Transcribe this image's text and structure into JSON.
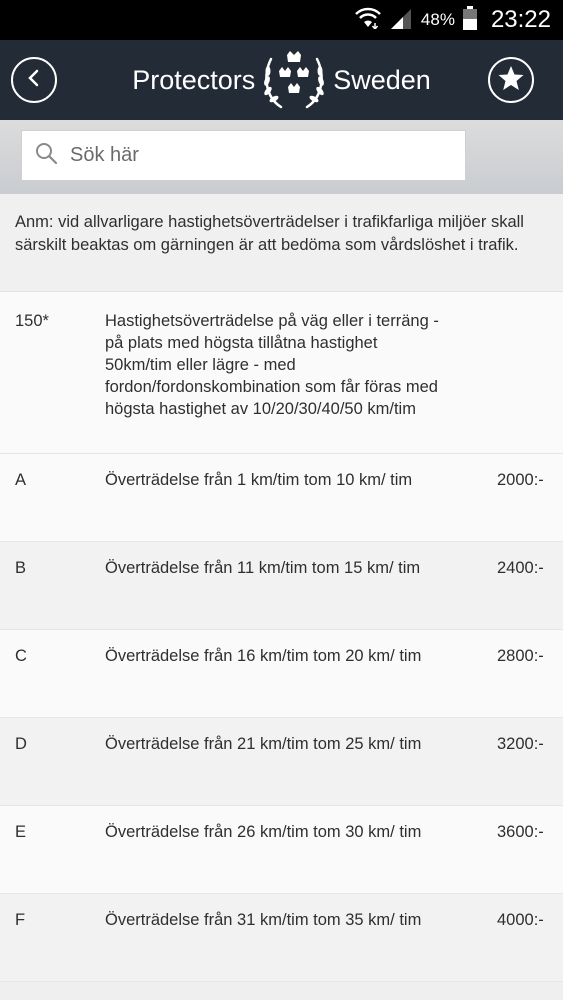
{
  "status_bar": {
    "battery": "48%",
    "time": "23:22"
  },
  "header": {
    "title_left": "Protectors",
    "title_right": "Sweden"
  },
  "search": {
    "placeholder": "Sök här"
  },
  "note": "Anm: vid allvarligare hastighetsöverträdelser i trafikfarliga miljöer skall särskilt beaktas om gärningen är att bedöma som vårdslöshet i trafik.",
  "section": {
    "code": "150*",
    "description": "Hastighetsöverträdelse på väg eller i terräng - på plats med högsta tillåtna hastighet 50km/tim eller lägre - med fordon/fordonskombination som får föras med högsta hastighet av 10/20/30/40/50 km/tim"
  },
  "items": [
    {
      "code": "A",
      "text": "Överträdelse från 1 km/tim tom 10 km/ tim",
      "price": "2000:-"
    },
    {
      "code": "B",
      "text": "Överträdelse från 11 km/tim tom 15 km/ tim",
      "price": "2400:-"
    },
    {
      "code": "C",
      "text": "Överträdelse från 16 km/tim tom 20 km/ tim",
      "price": "2800:-"
    },
    {
      "code": "D",
      "text": "Överträdelse från 21 km/tim tom 25 km/ tim",
      "price": "3200:-"
    },
    {
      "code": "E",
      "text": "Överträdelse från 26 km/tim tom 30 km/ tim",
      "price": "3600:-"
    },
    {
      "code": "F",
      "text": "Överträdelse från 31 km/tim tom 35 km/ tim",
      "price": "4000:-"
    }
  ],
  "icons": {
    "wifi": "wifi-icon",
    "signal": "signal-icon",
    "battery": "battery-icon",
    "back": "chevron-left-icon",
    "crest": "crown-wreath-icon",
    "favorite": "star-icon",
    "search": "search-icon"
  },
  "colors": {
    "header_bg": "#222b36",
    "status_bg": "#000000",
    "accent": "#ffffff"
  }
}
